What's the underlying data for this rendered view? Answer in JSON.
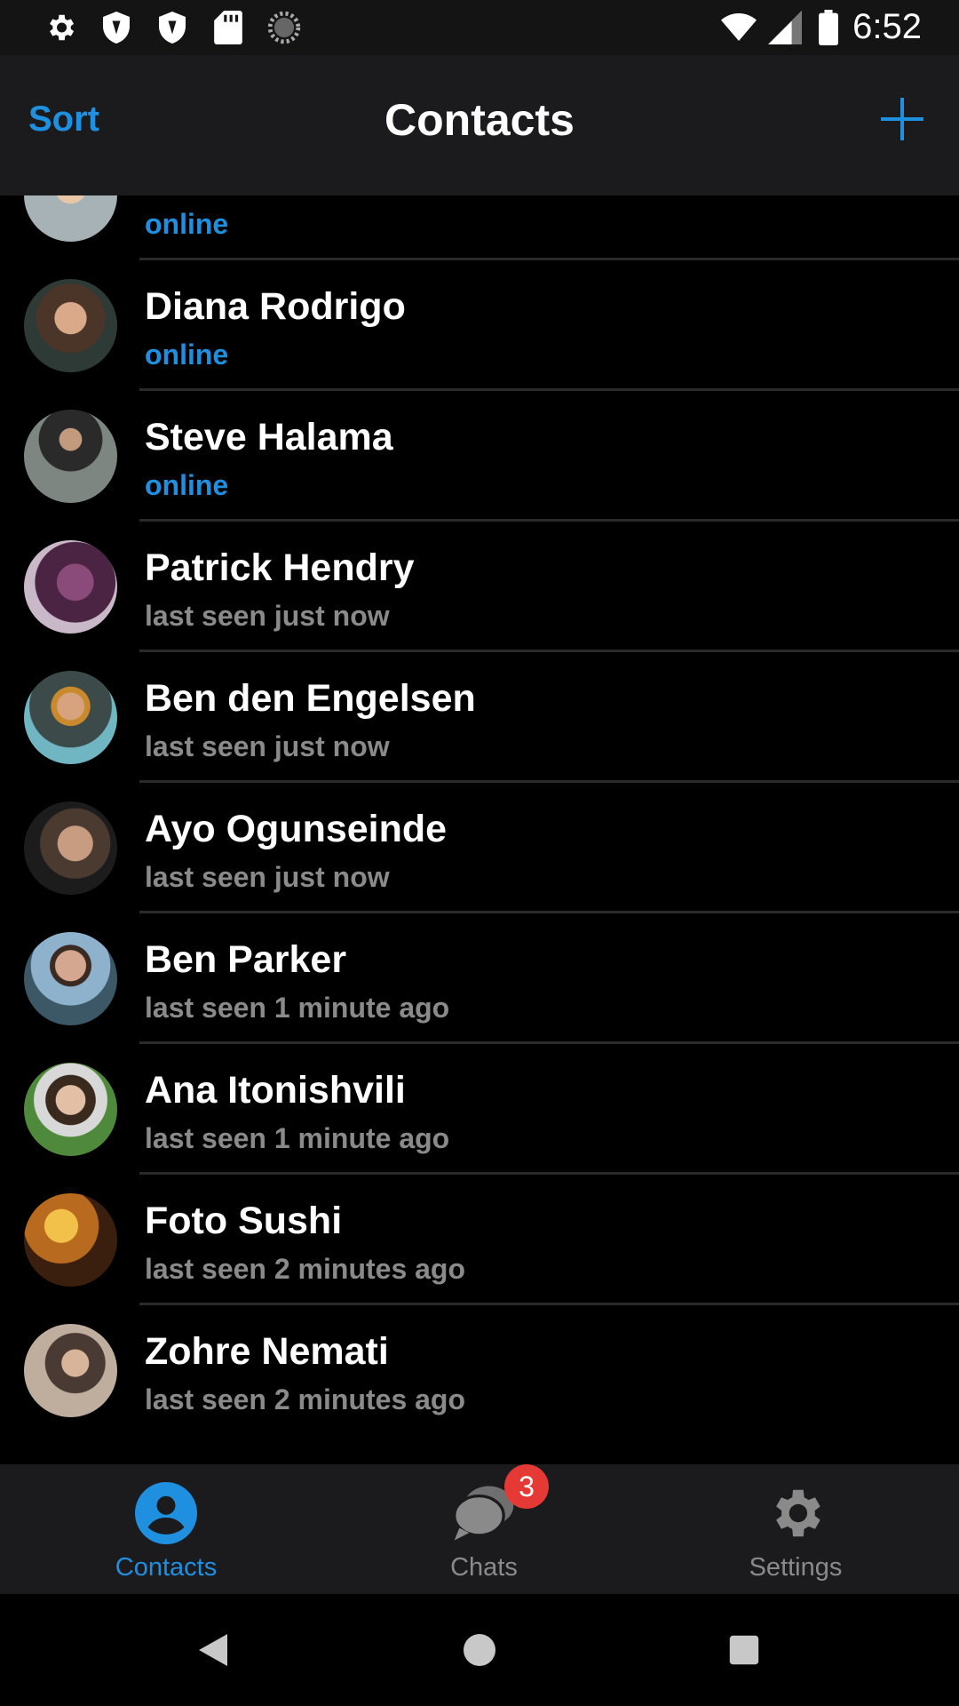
{
  "status_bar": {
    "time": "6:52",
    "left_icons": [
      "gear-icon",
      "shield-icon",
      "shield-icon",
      "sd-card-icon",
      "sync-icon"
    ],
    "right_icons": [
      "wifi-icon",
      "cellular-icon",
      "battery-icon"
    ]
  },
  "header": {
    "sort_label": "Sort",
    "title": "Contacts",
    "add_icon": "plus-icon"
  },
  "contacts": [
    {
      "name": "",
      "status": "online",
      "online": true
    },
    {
      "name": "Diana Rodrigo",
      "status": "online",
      "online": true
    },
    {
      "name": "Steve Halama",
      "status": "online",
      "online": true
    },
    {
      "name": "Patrick Hendry",
      "status": "last seen just now",
      "online": false
    },
    {
      "name": "Ben den Engelsen",
      "status": "last seen just now",
      "online": false
    },
    {
      "name": "Ayo Ogunseinde",
      "status": "last seen just now",
      "online": false
    },
    {
      "name": "Ben Parker",
      "status": "last seen 1 minute ago",
      "online": false
    },
    {
      "name": "Ana Itonishvili",
      "status": "last seen 1 minute ago",
      "online": false
    },
    {
      "name": "Foto Sushi",
      "status": "last seen 2 minutes ago",
      "online": false
    },
    {
      "name": "Zohre Nemati",
      "status": "last seen 2 minutes ago",
      "online": false
    }
  ],
  "tabs": [
    {
      "label": "Contacts",
      "icon": "person-icon",
      "active": true
    },
    {
      "label": "Chats",
      "icon": "chat-bubbles-icon",
      "active": false,
      "badge": "3"
    },
    {
      "label": "Settings",
      "icon": "gear-icon",
      "active": false
    }
  ],
  "nav_bar": [
    "back-icon",
    "home-icon",
    "recents-icon"
  ],
  "colors": {
    "accent": "#1f8fe0",
    "header_bg": "#1b1b1d",
    "list_bg": "#000000",
    "muted_text": "#8a8a8a",
    "badge": "#e53935"
  }
}
